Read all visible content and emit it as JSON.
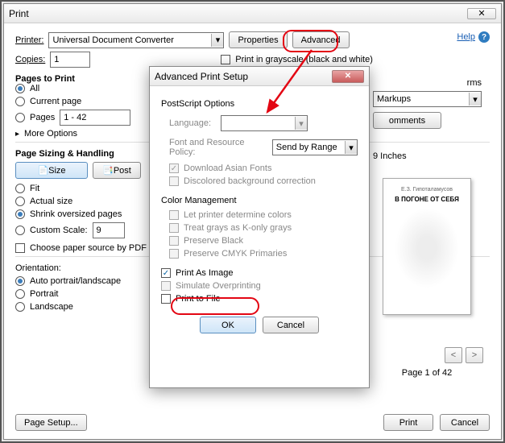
{
  "main": {
    "title": "Print",
    "printer_label": "Printer:",
    "printer_value": "Universal Document Converter",
    "properties_btn": "Properties",
    "advanced_btn": "Advanced",
    "help_link": "Help",
    "copies_label": "Copies:",
    "copies_value": "1",
    "grayscale_label": "Print in grayscale (black and white)",
    "pages_title": "Pages to Print",
    "radio_all": "All",
    "radio_current": "Current page",
    "radio_pages": "Pages",
    "pages_range": "1 - 42",
    "more_options": "More Options",
    "sizing_title": "Page Sizing & Handling",
    "size_btn": "Size",
    "post_btn": "Post",
    "fit": "Fit",
    "actual": "Actual size",
    "shrink": "Shrink oversized pages",
    "custom": "Custom Scale:",
    "custom_pct": "9",
    "choose_src": "Choose paper source by PDF p",
    "orientation": "Orientation:",
    "or_auto": "Auto portrait/landscape",
    "or_portrait": "Portrait",
    "or_landscape": "Landscape",
    "page_setup": "Page Setup...",
    "print_btn": "Print",
    "cancel_btn": "Cancel",
    "forms_partial": "rms",
    "markups": "Markups",
    "comments_partial": "omments",
    "inches_partial": "9 Inches",
    "page_of": "Page 1 of 42",
    "doc_author": "Е.З. Гипоталамусов",
    "doc_title": "В ПОГОНЕ ОТ СЕБЯ"
  },
  "adv": {
    "title": "Advanced Print Setup",
    "ps_options": "PostScript Options",
    "language": "Language:",
    "font_policy": "Font and Resource Policy:",
    "send_range": "Send by Range",
    "dl_asian": "Download Asian Fonts",
    "discolor": "Discolored background correction",
    "color_mgmt": "Color Management",
    "let_printer": "Let printer determine colors",
    "treat_gray": "Treat grays as K-only grays",
    "preserve_black": "Preserve Black",
    "preserve_cmyk": "Preserve CMYK Primaries",
    "print_image": "Print As Image",
    "sim_over": "Simulate Overprinting",
    "print_file": "Print to File",
    "ok": "OK",
    "cancel": "Cancel"
  }
}
